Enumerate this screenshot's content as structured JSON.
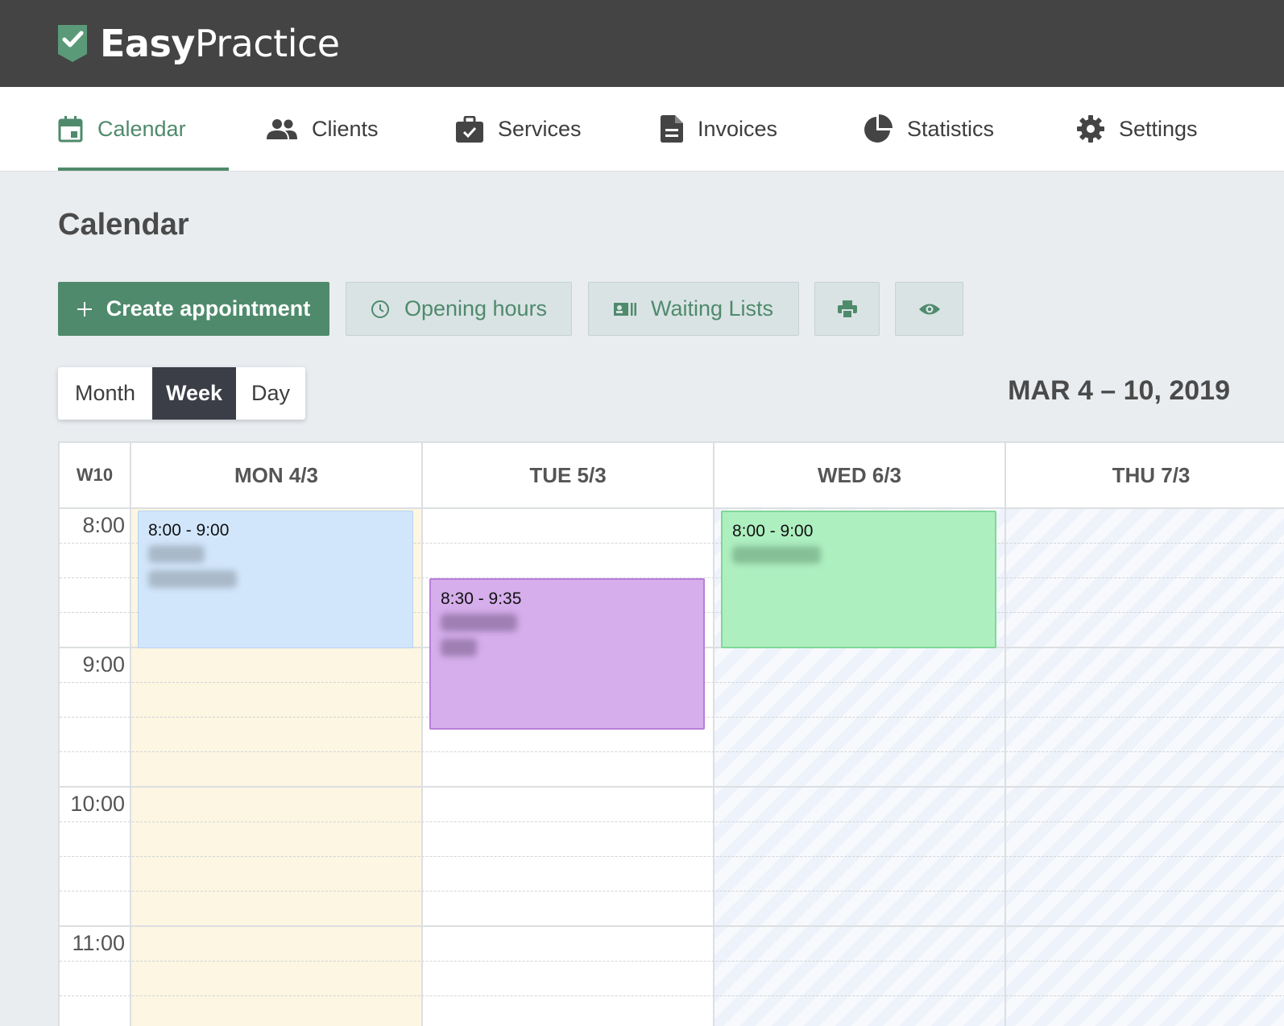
{
  "app": {
    "logo_bold": "Easy",
    "logo_light": "Practice"
  },
  "nav": {
    "items": [
      {
        "label": "Calendar",
        "icon": "calendar-icon",
        "active": true
      },
      {
        "label": "Clients",
        "icon": "people-icon"
      },
      {
        "label": "Services",
        "icon": "briefcase-check-icon"
      },
      {
        "label": "Invoices",
        "icon": "document-icon"
      },
      {
        "label": "Statistics",
        "icon": "pie-chart-icon"
      },
      {
        "label": "Settings",
        "icon": "gear-icon"
      }
    ]
  },
  "page": {
    "title": "Calendar"
  },
  "toolbar": {
    "create_label": "Create appointment",
    "opening_label": "Opening hours",
    "waiting_label": "Waiting Lists",
    "print_icon": "printer-icon",
    "preview_icon": "eye-icon"
  },
  "view_switcher": {
    "month": "Month",
    "week": "Week",
    "day": "Day",
    "selected": "Week"
  },
  "date_range": "MAR 4 – 10, 2019",
  "calendar": {
    "week_label": "W10",
    "days": [
      "MON 4/3",
      "TUE 5/3",
      "WED 6/3",
      "THU 7/3"
    ],
    "times": [
      "8:00",
      "9:00",
      "10:00",
      "11:00"
    ],
    "appointments": [
      {
        "day": "MON 4/3",
        "time": "8:00 - 9:00",
        "color": "#d2e6fb"
      },
      {
        "day": "TUE 5/3",
        "time": "8:30 - 9:35",
        "color": "#d5aeeb"
      },
      {
        "day": "WED 6/3",
        "time": "8:00 - 9:00",
        "color": "#aeefc0"
      }
    ]
  },
  "colors": {
    "brand": "#4f8a6c",
    "topbar": "#444444",
    "selected_view": "#3b3d47"
  }
}
